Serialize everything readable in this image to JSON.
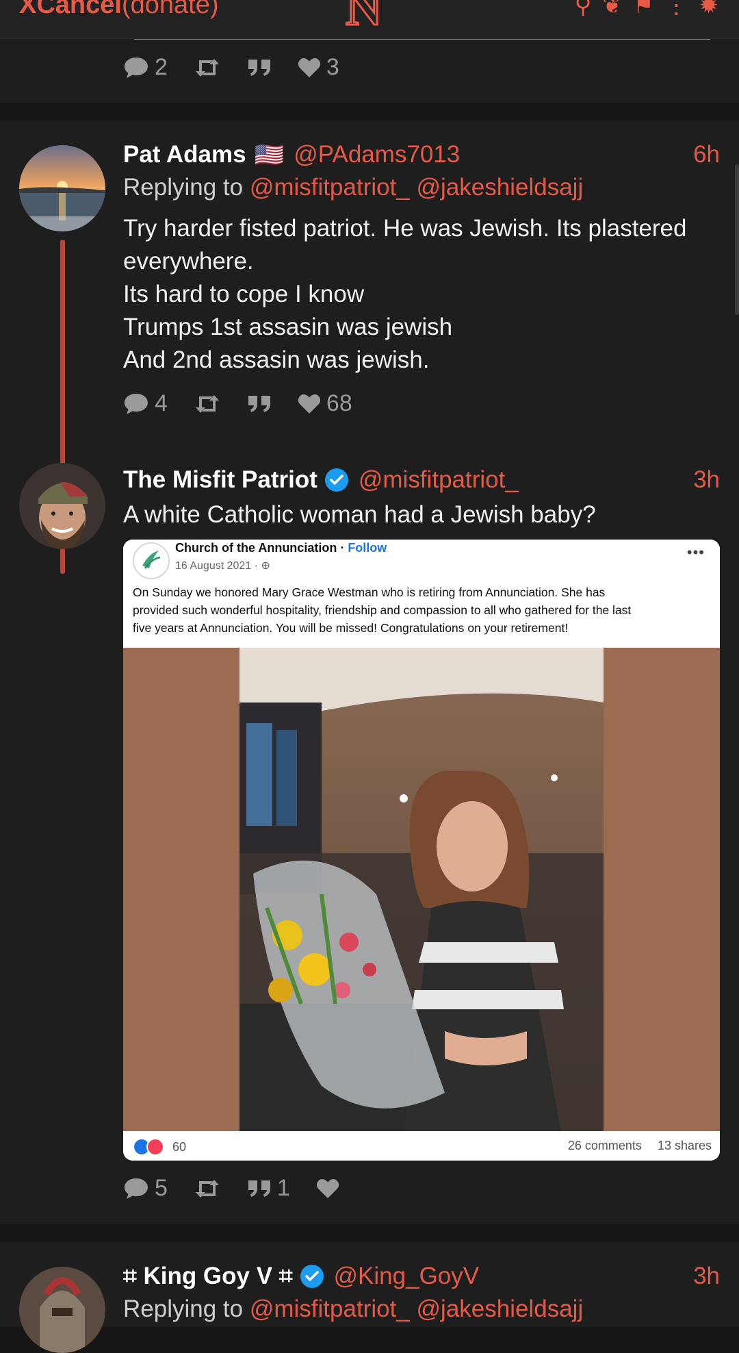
{
  "header": {
    "brand": "XCancel",
    "donate": "(donate)",
    "logo": "N",
    "icons": [
      "search-icon",
      "twitter-icon",
      "pin-icon",
      "more-icon",
      "gear-icon"
    ]
  },
  "colors": {
    "accent": "#e75a47",
    "background": "#161616",
    "card": "#1e1e1e",
    "muted": "#9a9a9a"
  },
  "posts": [
    {
      "stats": {
        "replies": "2",
        "retweets": "",
        "quotes": "",
        "likes": "3"
      }
    },
    {
      "name": "Pat Adams",
      "flag": "🇺🇸",
      "handle": "@PAdams7013",
      "time": "6h",
      "replying_label": "Replying to",
      "replying_to": [
        "@misfitpatriot_",
        "@jakeshieldsajj"
      ],
      "lines": [
        "Try harder fisted patriot. He was Jewish. Its plastered",
        "everywhere.",
        "Its hard to cope I know",
        "Trumps 1st assasin was jewish",
        "And 2nd assasin was jewish."
      ],
      "stats": {
        "replies": "4",
        "retweets": "",
        "quotes": "",
        "likes": "68"
      }
    },
    {
      "name": "The Misfit Patriot",
      "handle": "@misfitpatriot_",
      "time": "3h",
      "text": "A white Catholic woman had a Jewish baby?",
      "embed": {
        "page": "Church of the Annunciation",
        "follow": "Follow",
        "date": "16 August 2021 · ",
        "text_lines": [
          "On Sunday we honored Mary Grace Westman who is retiring from Annunciation. She has",
          "provided such wonderful hospitality, friendship and compassion to all who gathered for the last",
          "five years at Annunciation. You will be missed! Congratulations on your retirement!"
        ],
        "reactions": "60",
        "comments": "26 comments",
        "shares": "13 shares"
      },
      "stats": {
        "replies": "5",
        "retweets": "",
        "quotes": "1",
        "likes": ""
      }
    },
    {
      "name_prefix": "⌗",
      "name": "King Goy V",
      "name_suffix": "⌗",
      "handle": "@King_GoyV",
      "time": "3h",
      "replying_label": "Replying to",
      "replying_to": [
        "@misfitpatriot_",
        "@jakeshieldsajj"
      ]
    }
  ]
}
